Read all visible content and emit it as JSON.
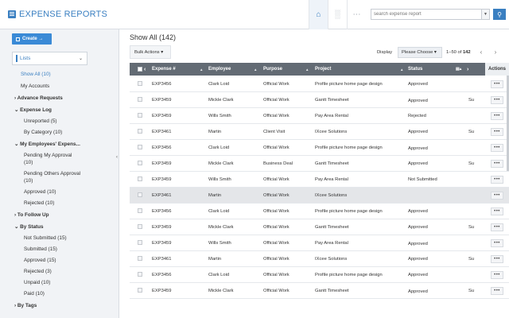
{
  "app": {
    "title": "EXPENSE REPORTS"
  },
  "topbar": {
    "search_placeholder": "search expense report",
    "search_dropdown_icon": "caret-down-icon",
    "home_icon": "home-icon",
    "chart_icon": "bar-chart-icon",
    "more_icon": "ellipsis-icon",
    "search_icon": "search-icon",
    "accent_color": "#3a7fc1"
  },
  "sidebar": {
    "create_label": "Create →",
    "lists_label": "Lists",
    "items": [
      {
        "label": "Show All (10)"
      },
      {
        "label": "My Accounts"
      },
      {
        "label": "Advance Requests"
      },
      {
        "label": "Expense Log"
      },
      {
        "label": "Unreported (5)"
      },
      {
        "label": "By Category (10)"
      },
      {
        "label": "My Employees' Expens..."
      },
      {
        "label": "Pending My Approval"
      },
      {
        "label": "(10)"
      },
      {
        "label": "Pending Others Approval"
      },
      {
        "label": "(10)"
      },
      {
        "label": "Approved (10)"
      },
      {
        "label": "Rejected (10)"
      },
      {
        "label": "To Follow Up"
      },
      {
        "label": "By Status"
      },
      {
        "label": "Not Submitted (15)"
      },
      {
        "label": "Submitted (15)"
      },
      {
        "label": "Approved (15)"
      },
      {
        "label": "Rejected (3)"
      },
      {
        "label": "Unpaid (10)"
      },
      {
        "label": "Paid (10)"
      },
      {
        "label": "By Tags"
      }
    ]
  },
  "main": {
    "title": "Show All (142)",
    "bulk_actions_label": "Bulk Actions ▾",
    "display_label": "Display",
    "display_select": "Please Choose ▾",
    "pager_range": "1–50 of ",
    "pager_total": "142",
    "prev_icon": "chevron-left-icon",
    "next_icon": "chevron-right-icon"
  },
  "table": {
    "headers": {
      "expense": "Expense #",
      "employee": "Employee",
      "purpose": "Purpose",
      "project": "Project",
      "status": "Status",
      "actions": "Actions"
    },
    "action_label": "•••",
    "rows": [
      {
        "expense": "EXP3456",
        "employee": "Clark Loid",
        "purpose": "Official Work",
        "project": "Profile picture home page design",
        "status": "Approved",
        "extra": ""
      },
      {
        "expense": "EXP3459",
        "employee": "Mickle Clark",
        "purpose": "Official Work",
        "project": "Gantt Timesheet",
        "status": "Approved",
        "extra": "Su"
      },
      {
        "expense": "EXP3459",
        "employee": "Wills Smith",
        "purpose": "Official Work",
        "project": "Pay Area Rental",
        "status": "Rejected",
        "extra": ""
      },
      {
        "expense": "EXP3461",
        "employee": "Martin",
        "purpose": "Client Visit",
        "project": "IXcee Solutions",
        "status": "Approved",
        "extra": "Su"
      },
      {
        "expense": "EXP3456",
        "employee": "Clark Loid",
        "purpose": "Official Work",
        "project": "Profile picture home page design",
        "status": "Approved",
        "extra": ""
      },
      {
        "expense": "EXP3459",
        "employee": "Mickle Clark",
        "purpose": "Business Deal",
        "project": "Gantt Timesheet",
        "status": "Approved",
        "extra": "Su"
      },
      {
        "expense": "EXP3459",
        "employee": "Wills Smith",
        "purpose": "Official Work",
        "project": "Pay Area Rental",
        "status": "Not Submitted",
        "extra": ""
      },
      {
        "expense": "EXP3461",
        "employee": "Martin",
        "purpose": "Official Work",
        "project": "IXcee Solutions",
        "status": "",
        "extra": ""
      },
      {
        "expense": "EXP3456",
        "employee": "Clark Loid",
        "purpose": "Official Work",
        "project": "Profile picture home page design",
        "status": "Approved",
        "extra": ""
      },
      {
        "expense": "EXP3459",
        "employee": "Mickle Clark",
        "purpose": "Official Work",
        "project": "Gantt Timesheet",
        "status": "Approved",
        "extra": "Su"
      },
      {
        "expense": "EXP3459",
        "employee": "Wills Smith",
        "purpose": "Official Work",
        "project": "Pay Area Rental",
        "status": "Approved",
        "extra": ""
      },
      {
        "expense": "EXP3461",
        "employee": "Martin",
        "purpose": "Official Work",
        "project": "IXcee Solutions",
        "status": "Approved",
        "extra": "Su"
      },
      {
        "expense": "EXP3456",
        "employee": "Clark Loid",
        "purpose": "Official Work",
        "project": "Profile picture home page design",
        "status": "Approved",
        "extra": ""
      },
      {
        "expense": "EXP3459",
        "employee": "Mickle Clark",
        "purpose": "Official Work",
        "project": "Gantt Timesheet",
        "status": "Approved",
        "extra": "Su"
      }
    ]
  }
}
